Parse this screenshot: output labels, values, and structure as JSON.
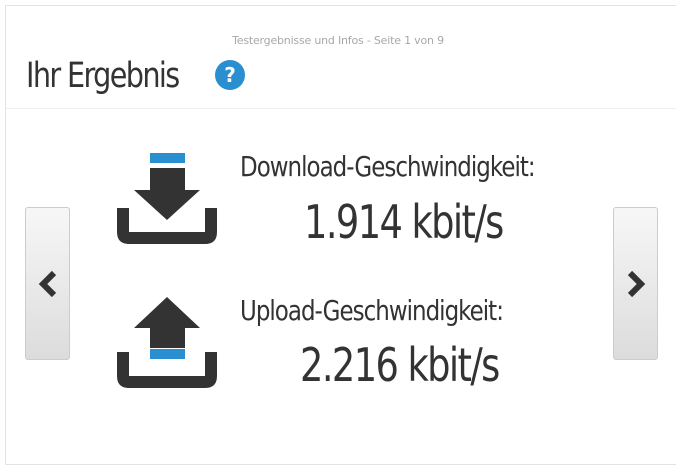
{
  "header": {
    "page_indicator": "Testergebnisse und Infos - Seite 1 von 9",
    "title": "Ihr Ergebnis",
    "help_icon": "question-circle-icon",
    "help_glyph": "?"
  },
  "navigation": {
    "prev_icon": "chevron-left-icon",
    "next_icon": "chevron-right-icon"
  },
  "download": {
    "icon": "download-icon",
    "label": "Download-Geschwindigkeit:",
    "value": "1.914 kbit/s"
  },
  "upload": {
    "icon": "upload-icon",
    "label": "Upload-Geschwindigkeit:",
    "value": "2.216 kbit/s"
  },
  "colors": {
    "accent_blue": "#2a8fd0",
    "icon_dark": "#333333",
    "text": "#333333",
    "muted": "#a8a8a8"
  }
}
